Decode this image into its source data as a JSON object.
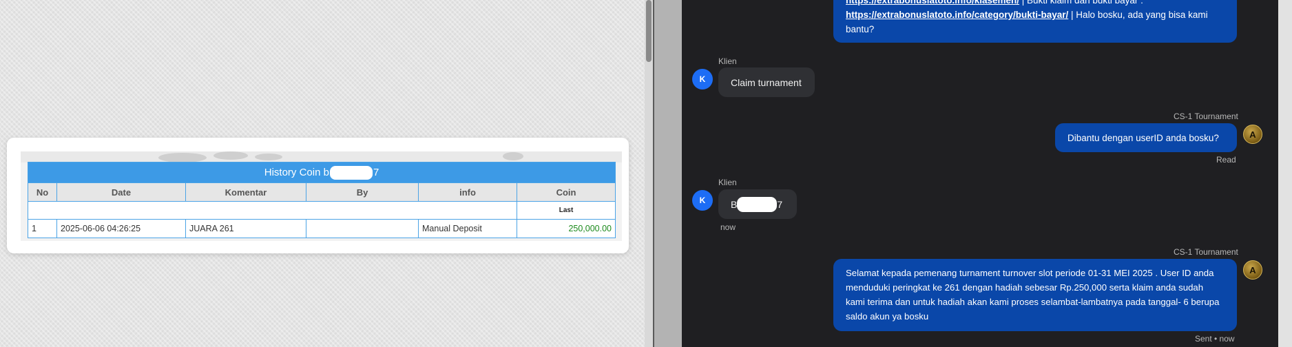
{
  "history_table": {
    "title_prefix": "History Coin b",
    "title_suffix": "7",
    "columns": [
      "No",
      "Date",
      "Komentar",
      "By",
      "info",
      "Coin"
    ],
    "sub_header_last": "Last",
    "rows": [
      {
        "no": "1",
        "date": "2025-06-06 04:26:25",
        "komentar": "JUARA 261",
        "by": "",
        "info": "Manual Deposit",
        "coin": "250,000.00"
      }
    ]
  },
  "chat": {
    "msg1": {
      "link1": "https://extrabonuslatoto.info/klasemen/",
      "text1": " | Bukti klaim dan bukti bayar :",
      "link2": "https://extrabonuslatoto.info/category/bukti-bayar/",
      "text2": " | Halo bosku, ada yang bisa kami bantu?"
    },
    "msg2": {
      "sender": "Klien",
      "avatar": "K",
      "text": "Claim turnament"
    },
    "msg3": {
      "sender": "CS-1 Tournament",
      "text": "Dibantu dengan userID anda bosku?",
      "status": "Read"
    },
    "msg4": {
      "sender": "Klien",
      "avatar": "K",
      "text_prefix": "B",
      "text_suffix": "7",
      "time": "now"
    },
    "msg5": {
      "sender": "CS-1 Tournament",
      "text": "Selamat kepada pemenang turnament turnover slot periode 01-31 MEI 2025 . User ID anda menduduki peringkat ke 261 dengan hadiah sebesar Rp.250,000 serta klaim anda sudah kami terima dan untuk hadiah akan kami proses selambat-lambatnya pada tanggal- 6 berupa saldo akun ya bosku",
      "status": "Sent • now"
    },
    "agent_avatar_letter": "A"
  },
  "colors": {
    "chat_bg": "#1f1f22",
    "outgoing_bubble": "#0a47a9",
    "incoming_bubble": "#2f3034",
    "table_header": "#3d9ae6",
    "coin_green": "#1c8a1c"
  }
}
